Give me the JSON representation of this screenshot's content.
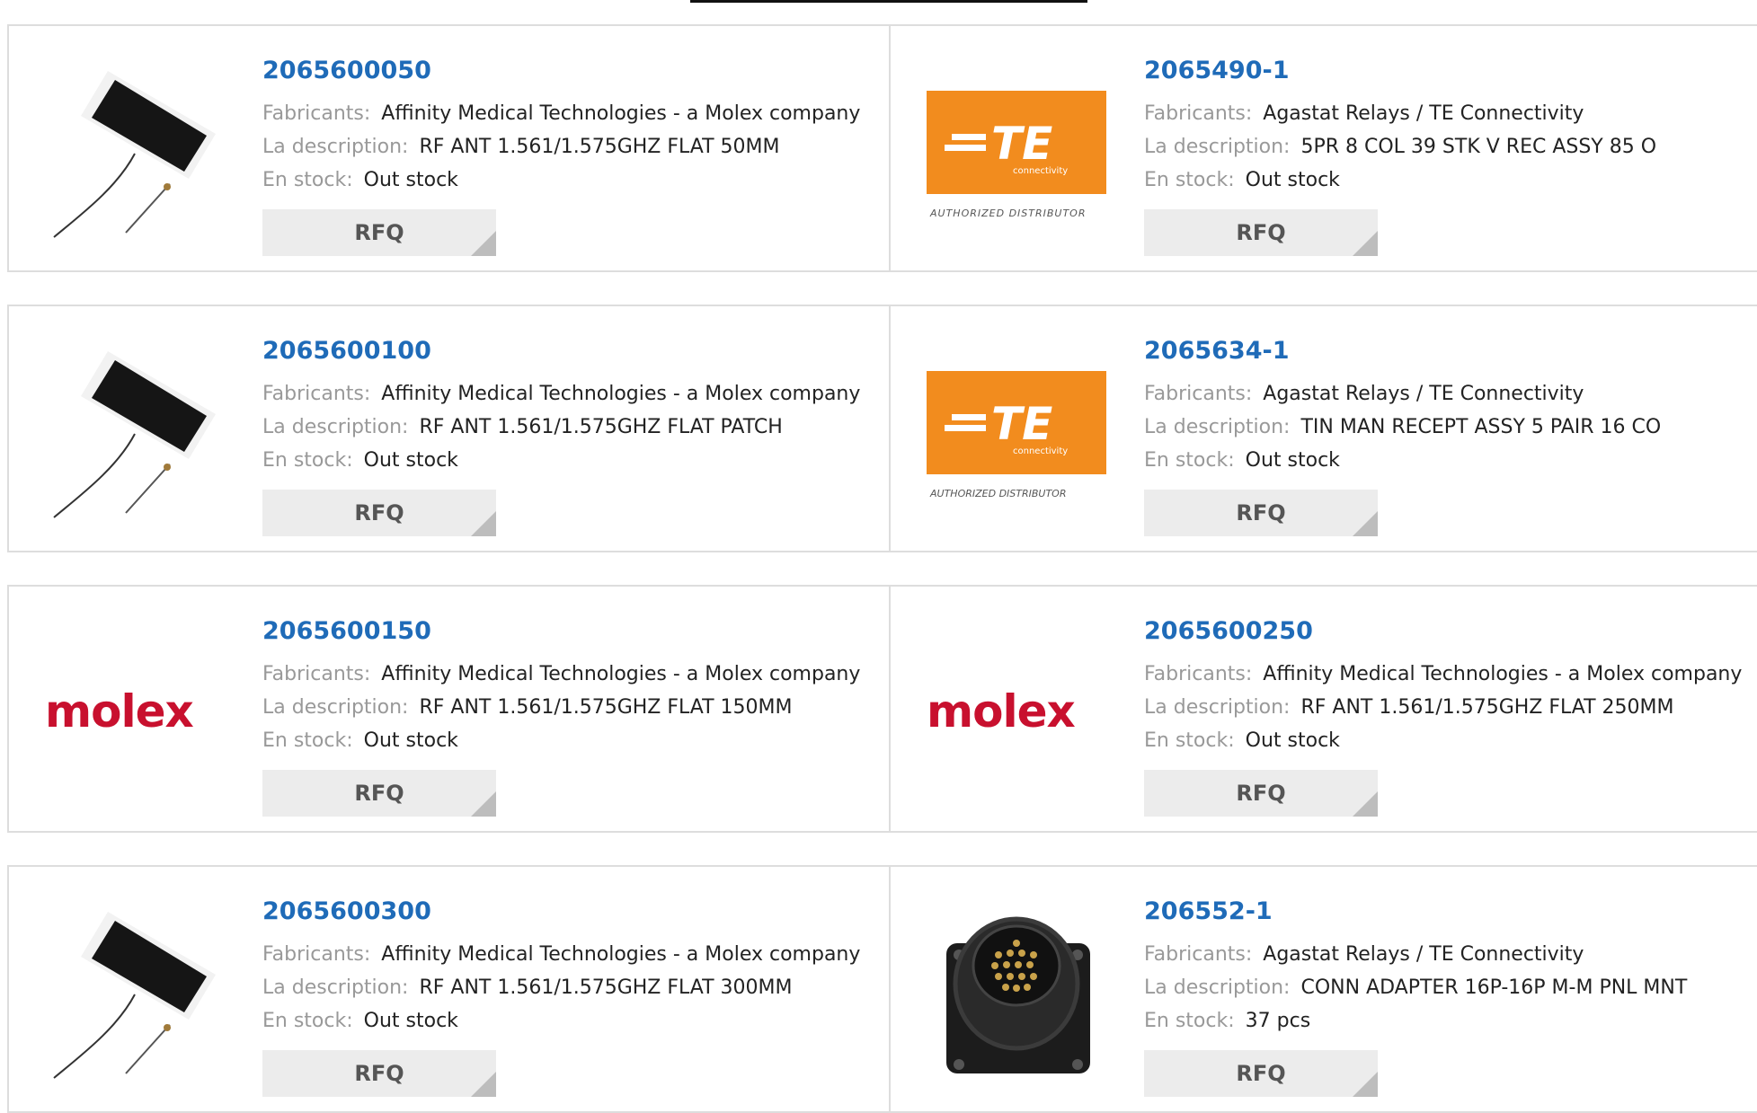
{
  "labels": {
    "manufacturer": "Fabricants:",
    "description": "La description:",
    "stock": "En stock:",
    "rfq": "RFQ"
  },
  "logos": {
    "molex": "molex",
    "te_main": "TE",
    "te_sub": "connectivity",
    "te_authorized": "AUTHORIZED DISTRIBUTOR"
  },
  "colors": {
    "part_link": "#1f6bb8",
    "molex_red": "#c8102e",
    "te_orange": "#f28c1e",
    "rfq_bg": "#ececec"
  },
  "products": [
    {
      "part": "2065600050",
      "manufacturer": "Affinity Medical Technologies - a Molex company",
      "description": "RF ANT 1.561/1.575GHZ FLAT 50MM",
      "stock": "Out stock",
      "image": "antenna-image"
    },
    {
      "part": "2065490-1",
      "manufacturer": "Agastat Relays / TE Connectivity",
      "description": "5PR 8 COL 39 STK V REC ASSY 85 O",
      "stock": "Out stock",
      "image": "te-logo"
    },
    {
      "part": "2065600100",
      "manufacturer": "Affinity Medical Technologies - a Molex company",
      "description": "RF ANT 1.561/1.575GHZ FLAT PATCH",
      "stock": "Out stock",
      "image": "antenna-image"
    },
    {
      "part": "2065634-1",
      "manufacturer": "Agastat Relays / TE Connectivity",
      "description": "TIN MAN RECEPT ASSY 5 PAIR 16 CO",
      "stock": "Out stock",
      "image": "te-logo"
    },
    {
      "part": "2065600150",
      "manufacturer": "Affinity Medical Technologies - a Molex company",
      "description": "RF ANT 1.561/1.575GHZ FLAT 150MM",
      "stock": "Out stock",
      "image": "molex-logo"
    },
    {
      "part": "2065600250",
      "manufacturer": "Affinity Medical Technologies - a Molex company",
      "description": "RF ANT 1.561/1.575GHZ FLAT 250MM",
      "stock": "Out stock",
      "image": "molex-logo"
    },
    {
      "part": "2065600300",
      "manufacturer": "Affinity Medical Technologies - a Molex company",
      "description": "RF ANT 1.561/1.575GHZ FLAT 300MM",
      "stock": "Out stock",
      "image": "antenna-image"
    },
    {
      "part": "206552-1",
      "manufacturer": "Agastat Relays / TE Connectivity",
      "description": "CONN ADAPTER 16P-16P M-M PNL MNT",
      "stock": "37 pcs",
      "image": "connector-image"
    }
  ]
}
